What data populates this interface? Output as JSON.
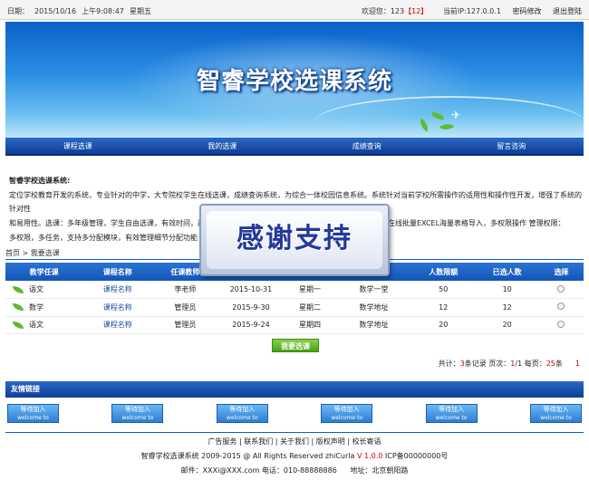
{
  "topbar": {
    "date_label": "日期：",
    "date": "2015/10/16",
    "time": "上午9:08:47",
    "weekday": "星期五",
    "welcome": "欢迎您：",
    "user": "123",
    "user_id": "【12】",
    "ip_label": "当前IP:",
    "ip": "127.0.0.1",
    "change_password": "密码修改",
    "logout": "退出登陆"
  },
  "banner": {
    "title": "智睿学校选课系统"
  },
  "nav": [
    "课程选课",
    "我的选课",
    "成绩查询",
    "留言咨询"
  ],
  "intro": {
    "heading": "智睿学校选课系统:",
    "lines": [
      "定位学校教育开发的系统，专业针对的中学，大专院校学生在线选课，成绩查询系统，为综合一体校园信息系统。系统针对当前学校所需操作的适用性和操作性开发，增强了系统的针对性",
      "和易用性。选课：多年级管理，学生自由选课，有效时间，选课",
      "多权限，多任务，支持多分配模块，有效管理细节分配功能 课"
    ],
    "line2_tail": "分配，在线批量EXCEL海量表格导入，多权限操作 管理权限："
  },
  "breadcrumb": {
    "home": "首页",
    "sep": " > ",
    "current": "我要选课"
  },
  "table": {
    "headers": [
      "教学任课",
      "课程名称",
      "任课教师",
      "",
      "",
      "课程学分",
      "人数限额",
      "已选人数",
      "选择"
    ],
    "rows": [
      [
        "语文",
        "课程名称",
        "李老师",
        "2015-10-31",
        "星期一",
        "数学一堂",
        "50",
        "10",
        "1"
      ],
      [
        "数学",
        "课程名称",
        "管理员",
        "2015-9-30",
        "星期二",
        "数学地址",
        "12",
        "12",
        "1"
      ],
      [
        "语文",
        "课程名称",
        "管理员",
        "2015-9-24",
        "星期四",
        "数学地址",
        "20",
        "20",
        "0"
      ]
    ]
  },
  "select_button": "我要选课",
  "pager": {
    "total_prefix": "共计：",
    "total": "3",
    "total_suffix": "条记录",
    "page_prefix": " 页次：",
    "page": "1",
    "page_sep": "/1",
    "per_page_prefix": " 每页：",
    "per_page": "25",
    "per_page_suffix": "条",
    "current": "1"
  },
  "friend_links": {
    "title": "友情链接",
    "logos": [
      {
        "top": "等待加入",
        "bottom": "welcome to"
      },
      {
        "top": "等待加入",
        "bottom": "welcome to"
      },
      {
        "top": "等待加入",
        "bottom": "welcome to"
      },
      {
        "top": "等待加入",
        "bottom": "welcome to"
      },
      {
        "top": "等待加入",
        "bottom": "welcome to"
      },
      {
        "top": "等待加入",
        "bottom": "welcome to"
      }
    ]
  },
  "footer": {
    "links": [
      "广告服务",
      "联系我们",
      "关于我们",
      "版权声明",
      "校长寄语"
    ],
    "sep": " | ",
    "copyright_pre": "智睿学校选课系统 2009-2015 @ All Rights Reserved zhiCurla ",
    "version": "V 1.0.0",
    "icp": " ICP备00000000号",
    "email_label": "邮件：",
    "email": "XXXi@XXX.com",
    "phone_label": "电话：",
    "phone": "010-88888886",
    "address_label": "地址：",
    "address": "北京朝阳路"
  },
  "overlay": {
    "text": "感谢支持"
  }
}
